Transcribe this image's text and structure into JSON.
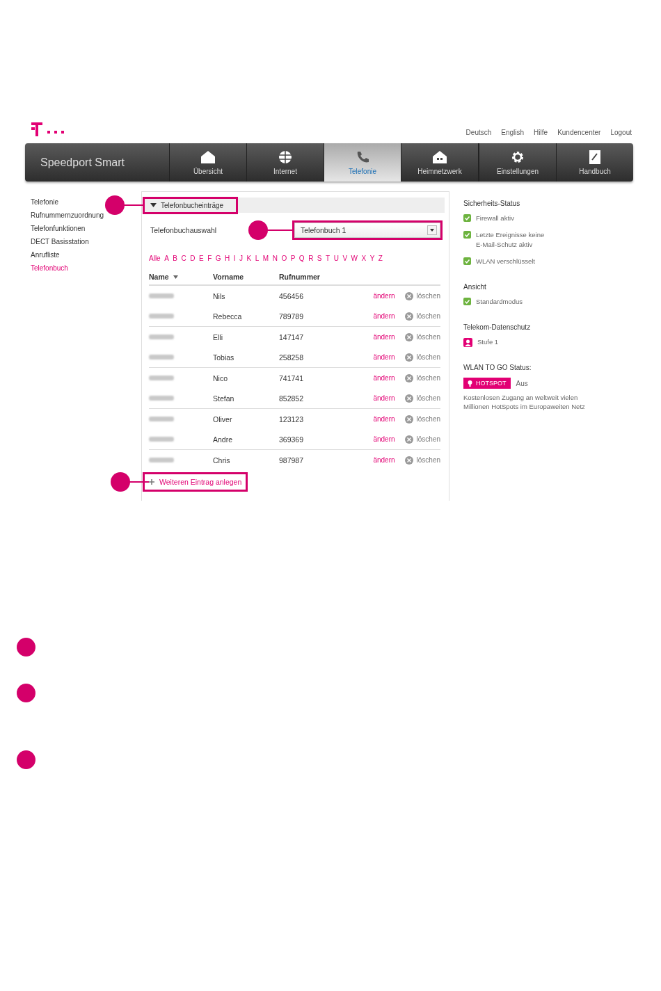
{
  "header": {
    "top_links": [
      "Deutsch",
      "English",
      "Hilfe",
      "Kundencenter",
      "Logout"
    ]
  },
  "nav": {
    "brand": "Speedport Smart",
    "items": [
      {
        "label": "Übersicht",
        "selected": false
      },
      {
        "label": "Internet",
        "selected": false
      },
      {
        "label": "Telefonie",
        "selected": true
      },
      {
        "label": "Heimnetzwerk",
        "selected": false
      },
      {
        "label": "Einstellungen",
        "selected": false
      },
      {
        "label": "Handbuch",
        "selected": false
      }
    ]
  },
  "sidebar": {
    "items": [
      {
        "label": "Telefonie",
        "selected": false
      },
      {
        "label": "Rufnummernzuordnung",
        "selected": false
      },
      {
        "label": "Telefonfunktionen",
        "selected": false
      },
      {
        "label": "DECT Basisstation",
        "selected": false
      },
      {
        "label": "Anrufliste",
        "selected": false
      },
      {
        "label": "Telefonbuch",
        "selected": true
      }
    ]
  },
  "panel": {
    "title": "Telefonbucheinträge",
    "expanded": true,
    "highlighted": true,
    "select_label": "Telefonbuchauswahl",
    "select": {
      "value": "Telefonbuch 1",
      "highlighted": true
    },
    "letters": [
      "Alle",
      "A",
      "B",
      "C",
      "D",
      "E",
      "F",
      "G",
      "H",
      "I",
      "J",
      "K",
      "L",
      "M",
      "N",
      "O",
      "P",
      "Q",
      "R",
      "S",
      "T",
      "U",
      "V",
      "W",
      "X",
      "Y",
      "Z"
    ],
    "columns": [
      "Name",
      "Vorname",
      "Rufnummer"
    ],
    "rows": [
      {
        "first_name": "Nils",
        "number": "456456",
        "edit": "ändern",
        "delete": "löschen"
      },
      {
        "first_name": "Rebecca",
        "number": "789789",
        "edit": "ändern",
        "delete": "löschen"
      },
      {
        "first_name": "Elli",
        "number": "147147",
        "edit": "ändern",
        "delete": "löschen"
      },
      {
        "first_name": "Tobias",
        "number": "258258",
        "edit": "ändern",
        "delete": "löschen"
      },
      {
        "first_name": "Nico",
        "number": "741741",
        "edit": "ändern",
        "delete": "löschen"
      },
      {
        "first_name": "Stefan",
        "number": "852852",
        "edit": "ändern",
        "delete": "löschen"
      },
      {
        "first_name": "Oliver",
        "number": "123123",
        "edit": "ändern",
        "delete": "löschen"
      },
      {
        "first_name": "Andre",
        "number": "369369",
        "edit": "ändern",
        "delete": "löschen"
      },
      {
        "first_name": "Chris",
        "number": "987987",
        "edit": "ändern",
        "delete": "löschen"
      }
    ],
    "add_link": {
      "label": "Weiteren Eintrag anlegen",
      "highlighted": true
    }
  },
  "status": {
    "sections": [
      {
        "title": "Sicherheits-Status",
        "items": [
          {
            "kind": "ok",
            "lines": [
              "Firewall aktiv"
            ]
          },
          {
            "kind": "ok",
            "lines": [
              "Letzte Ereignisse keine",
              "E-Mail-Schutz aktiv"
            ]
          },
          {
            "kind": "ok",
            "lines": [
              "WLAN verschlüsselt"
            ]
          }
        ]
      },
      {
        "title": "Ansicht",
        "items": [
          {
            "kind": "ok",
            "lines": [
              "Standardmodus"
            ]
          }
        ]
      },
      {
        "title": "Telekom-Datenschutz",
        "items": [
          {
            "kind": "privacy",
            "lines": [
              "Stufe 1"
            ]
          }
        ]
      }
    ],
    "hotspot": {
      "title": "WLAN TO GO Status:",
      "badge": "HOTSPOT",
      "state": "Aus",
      "note": "Kostenlosen Zugang an weltweit vielen Millionen HotSpots im Europaweiten Netz"
    }
  },
  "legend": [
    {
      "kind": "marker"
    },
    {
      "kind": "marker"
    },
    {
      "kind": "marker"
    }
  ]
}
